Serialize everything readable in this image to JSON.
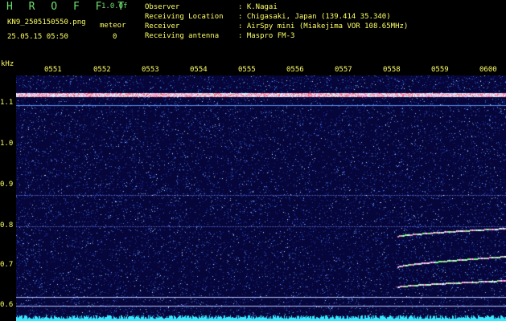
{
  "header": {
    "title": "H R O F F T",
    "version": "1.0.0f",
    "filename": "KN9_2505150550.png",
    "datetime": "25.05.15 05:50",
    "meteor_label": "meteor",
    "meteor_count": "0"
  },
  "info": [
    {
      "label": "Observer",
      "value": ": K.Nagai"
    },
    {
      "label": "Receiving Location",
      "value": ": Chigasaki, Japan (139.414 35.340)"
    },
    {
      "label": "Receiver",
      "value": ": AirSpy mini (Miakejima VOR 108.65MHz)"
    },
    {
      "label": "Receiving antenna",
      "value": ": Maspro FM-3"
    }
  ],
  "axes": {
    "unit": "kHz",
    "y_ticks": [
      "1.1",
      "1.0",
      "0.9",
      "0.8",
      "0.7",
      "0.6"
    ],
    "x_ticks": [
      "0551",
      "0552",
      "0553",
      "0554",
      "0555",
      "0556",
      "0557",
      "0558",
      "0559",
      "0600"
    ]
  },
  "colors": {
    "background": "#06063a",
    "label": "#ffff66",
    "title": "#6fe06f"
  }
}
